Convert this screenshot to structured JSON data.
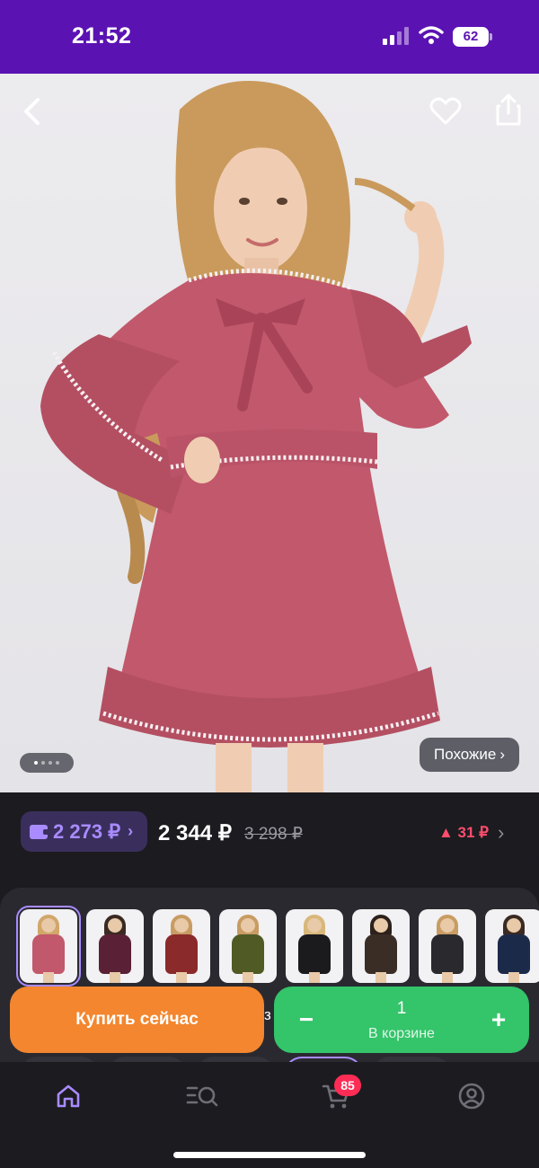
{
  "status_bar": {
    "time": "21:52",
    "battery": "62"
  },
  "product": {
    "similar_label": "Похожие",
    "gallery_dots": 4
  },
  "price": {
    "wallet_amount": "2 273 ₽",
    "current": "2 344 ₽",
    "old": "3 298 ₽",
    "change": "▲ 31 ₽"
  },
  "variants": {
    "thumbnails": [
      {
        "dress": "#c2586b",
        "hair": "#d1a76a"
      },
      {
        "dress": "#5a2035",
        "hair": "#3a2a22"
      },
      {
        "dress": "#8a2a2a",
        "hair": "#c89c62"
      },
      {
        "dress": "#4f5a25",
        "hair": "#c89c62"
      },
      {
        "dress": "#1b1b1d",
        "hair": "#d8b87a"
      },
      {
        "dress": "#3a2d26",
        "hair": "#2c211c"
      },
      {
        "dress": "#2a2a2e",
        "hair": "#c89c62"
      },
      {
        "dress": "#1c2a4a",
        "hair": "#3a2a22"
      }
    ]
  },
  "actions": {
    "buy_now": "Купить сейчас",
    "peek_text": "з",
    "quantity": "1",
    "in_cart": "В корзине",
    "minus": "−",
    "plus": "+"
  },
  "nav": {
    "cart_badge": "85"
  },
  "colors": {
    "status_bar": "#5b12b3",
    "accent": "#a98bff",
    "buy": "#f3862e",
    "cart": "#34c46a",
    "price_up": "#ff4d6d"
  }
}
